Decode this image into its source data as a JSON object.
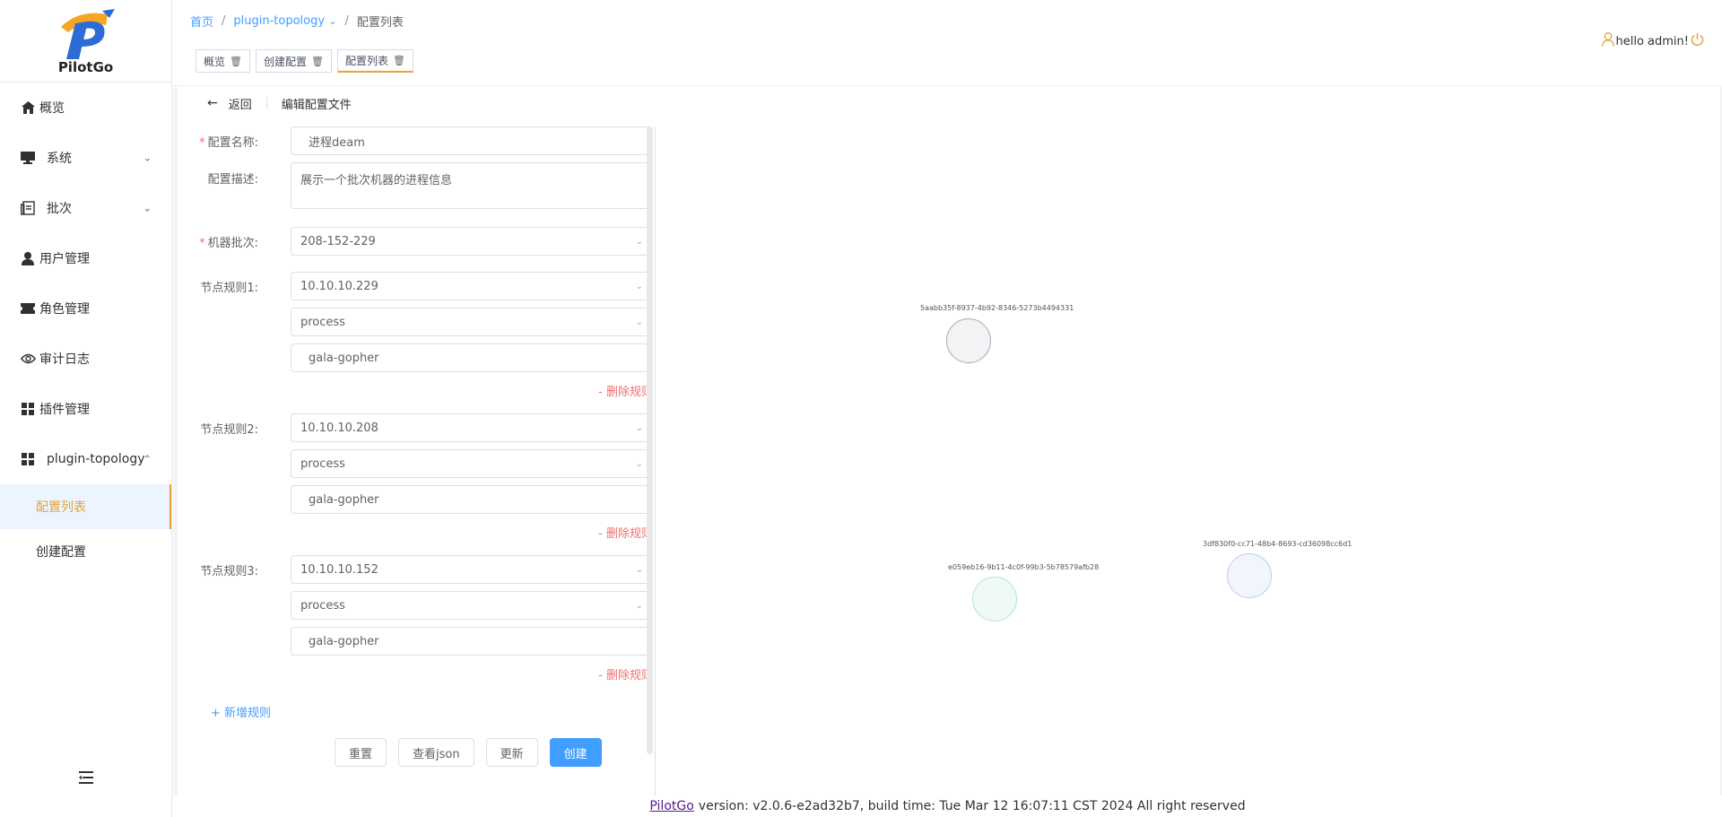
{
  "app": {
    "name": "PilotGo",
    "colors": {
      "accent": "#e6a23c",
      "primary": "#409eff",
      "danger": "#f56c6c"
    }
  },
  "sidebar": {
    "items": [
      {
        "label": "概览",
        "icon": "home-icon"
      },
      {
        "label": "系统",
        "icon": "monitor-icon",
        "expandable": true
      },
      {
        "label": "批次",
        "icon": "batch-icon",
        "expandable": true
      },
      {
        "label": "用户管理",
        "icon": "user-icon"
      },
      {
        "label": "角色管理",
        "icon": "ticket-icon"
      },
      {
        "label": "审计日志",
        "icon": "eye-icon"
      },
      {
        "label": "插件管理",
        "icon": "grid-icon"
      },
      {
        "label": "plugin-topology",
        "icon": "grid-icon",
        "expanded": true
      }
    ],
    "sub_items": [
      {
        "label": "配置列表",
        "active": true
      },
      {
        "label": "创建配置",
        "active": false
      }
    ]
  },
  "header": {
    "breadcrumb": {
      "home": "首页",
      "plugin": "plugin-topology",
      "current": "配置列表"
    },
    "tabs": [
      {
        "label": "概览",
        "active": false
      },
      {
        "label": "创建配置",
        "active": false
      },
      {
        "label": "配置列表",
        "active": true
      }
    ],
    "user_greeting": "hello admin!"
  },
  "page": {
    "back_label": "返回",
    "title": "编辑配置文件"
  },
  "form": {
    "name_label": "配置名称:",
    "name_value": "进程deam",
    "desc_label": "配置描述:",
    "desc_value": "展示一个批次机器的进程信息",
    "batch_label": "机器批次:",
    "batch_value": "208-152-229",
    "rules": [
      {
        "label": "节点规则1:",
        "node": "10.10.10.229",
        "type": "process",
        "name": "gala-gopher",
        "delete": "- 删除规则"
      },
      {
        "label": "节点规则2:",
        "node": "10.10.10.208",
        "type": "process",
        "name": "gala-gopher",
        "delete": "- 删除规则"
      },
      {
        "label": "节点规则3:",
        "node": "10.10.10.152",
        "type": "process",
        "name": "gala-gopher",
        "delete": "- 删除规则"
      }
    ],
    "add_rule": "+ 新增规则",
    "buttons": {
      "reset": "重置",
      "view_json": "查看json",
      "update": "更新",
      "create": "创建"
    }
  },
  "topology": {
    "nodes": [
      {
        "id": "5aabb35f-8937-4b92-8346-5273b4494331",
        "fill": "#f2f3f5",
        "stroke": "#a8abb2"
      },
      {
        "id": "e059eb16-9b11-4c0f-99b3-5b78579afb28",
        "fill": "#f0faf5",
        "stroke": "#b3e6cc"
      },
      {
        "id": "3df830f0-cc71-48b4-8693-cd36098cc6d1",
        "fill": "#f2f6fc",
        "stroke": "#b8cde6"
      }
    ]
  },
  "footer": {
    "link": "PilotGo",
    "text": "version: v2.0.6-e2ad32b7, build time: Tue Mar 12 16:07:11 CST 2024 All right reserved"
  }
}
